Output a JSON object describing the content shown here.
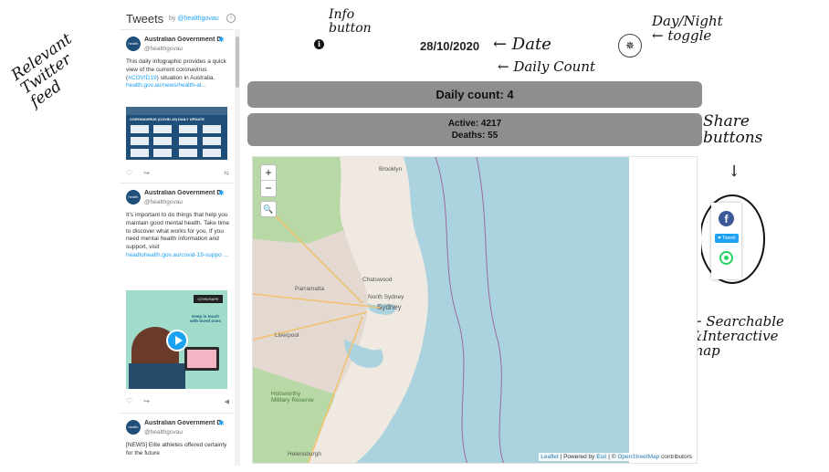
{
  "annotations": {
    "feed": "Relevant\nTwitter\nfeed",
    "info": "Info\nbutton",
    "date": "← Date",
    "toggle": "Day/Night\n← toggle",
    "daily": "← Daily Count",
    "share": "Share\nbuttons",
    "map": "← Searchable\n&Interactive\nmap"
  },
  "twitter": {
    "title": "Tweets",
    "by": "by",
    "handle": "@healthgovau",
    "tweets": [
      {
        "name": "Australian Government D",
        "handle": "@healthgovau",
        "text": "This daily infographic provides a quick view of the current coronavirus (",
        "hashtag": "#COVID19",
        "text2": ") situation in Australia.",
        "link": "health.gov.au/news/health-al...",
        "image_title": "CORONAVIRUS (COVID-19) DAILY UPDATE",
        "likes": "♡",
        "share": "↪"
      },
      {
        "name": "Australian Government D",
        "handle": "@healthgovau",
        "text": "It's important to do things that help you maintain good mental health. Take time to discover what works for you. If you need mental health information and support, visit",
        "link": "headtohealth.gov.au/covid-19-suppo ...",
        "image_badge": "COVIDSAFE",
        "image_text": "Keep in touch with loved ones",
        "likes": "♡",
        "share": "↪"
      },
      {
        "name": "Australian Government D",
        "handle": "@healthgovau",
        "text": "[NEWS] Elite athletes offered certainty for the future"
      }
    ]
  },
  "app": {
    "info_icon": "i",
    "date": "28/10/2020",
    "toggle_icon": "✵",
    "daily_count": "Daily count: 4",
    "active": "Active: 4217",
    "deaths": "Deaths: 55"
  },
  "map": {
    "zoom_in": "+",
    "zoom_out": "−",
    "search_icon": "🔍",
    "labels": {
      "city": "Sydney",
      "north_sydney": "North Sydney",
      "chatswood": "Chatswood",
      "parramatta": "Parramatta",
      "brooklyn": "Brooklyn",
      "liverpool": "Liverpool",
      "holsworthy": "Holsworthy Military Reserve",
      "helensburgh": "Helensburgh"
    },
    "attribution": {
      "leaflet": "Leaflet",
      "powered": " | Powered by ",
      "esri": "Esri",
      "sep": " | © ",
      "osm": "OpenStreetMap",
      "contrib": " contributors"
    },
    "colors": {
      "sea": "#aad3df",
      "land": "#efe9e1",
      "park": "#b8d9a6",
      "urban": "#e4d9d0"
    }
  },
  "share": {
    "facebook_icon": "f",
    "tweet_label": "♥ Tweet"
  }
}
